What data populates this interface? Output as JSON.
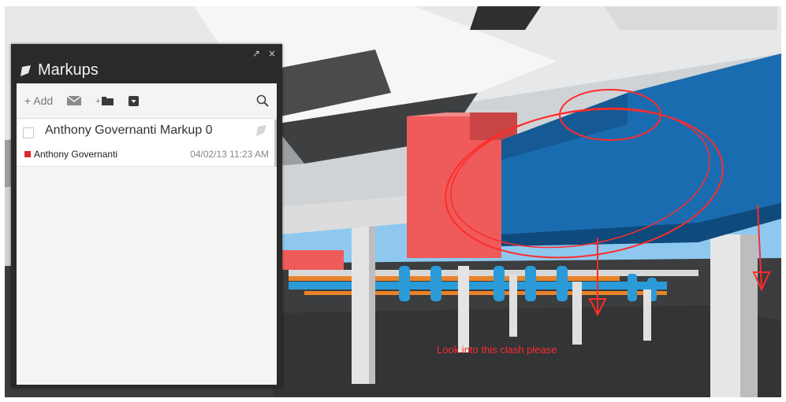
{
  "panel": {
    "title": "Markups",
    "controls": {
      "popout_glyph": "↗",
      "close_glyph": "×"
    },
    "toolbar": {
      "add_label": "+ Add",
      "email_icon": "email-icon",
      "new_folder_icon": "new-folder-icon",
      "dropdown_icon": "dropdown-icon",
      "search_icon": "search-icon"
    },
    "items": [
      {
        "title": "Anthony Governanti Markup 0",
        "author": "Anthony Governanti",
        "author_color": "#e0242b",
        "date": "04/02/13 11:23 AM"
      }
    ]
  },
  "annotation": {
    "text": "Look into this clash please",
    "color": "#ff2b2b"
  },
  "colors": {
    "duct_blue": "#1a6cb0",
    "duct_red": "#ef5a5a",
    "pipe_cyan": "#2a9bd8",
    "pipe_orange": "#e8832a"
  }
}
